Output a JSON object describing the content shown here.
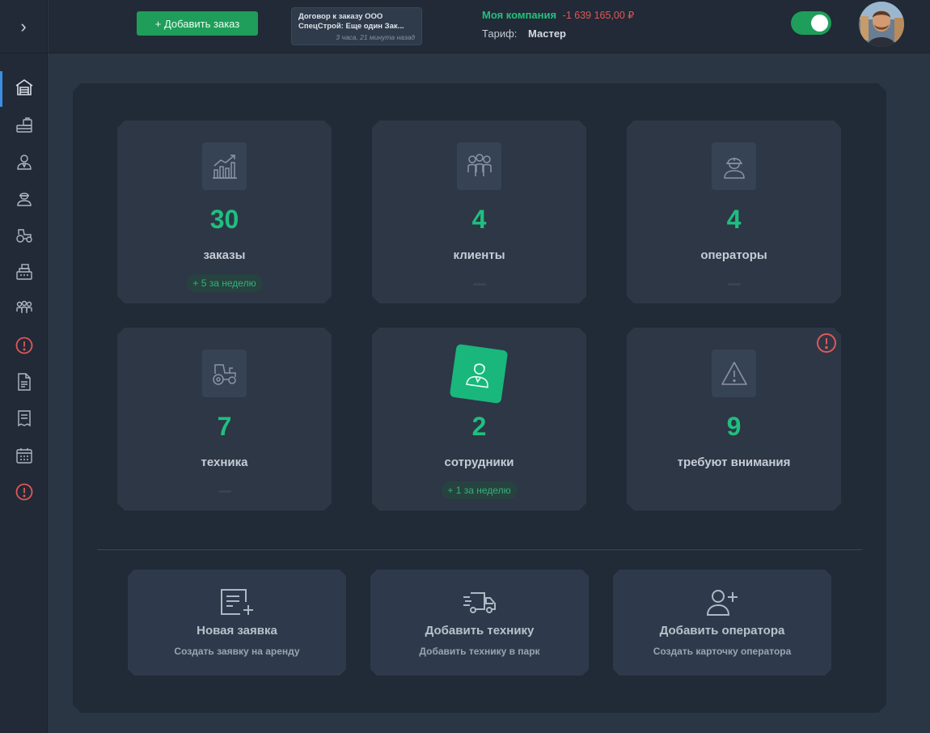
{
  "header": {
    "add_order_label": "+ Добавить заказ",
    "notification": {
      "title_line1": "Договор к заказу ООО",
      "title_line2": "СпецСтрой: Еще один Зак...",
      "time": "3 часа, 21 минута назад"
    },
    "company_name": "Моя компания",
    "company_balance": "-1 639 165,00 ₽",
    "tariff_label": "Тариф:",
    "tariff_value": "Мастер",
    "toggle_on": true
  },
  "sidebar": {
    "items": [
      {
        "icon": "warehouse-icon",
        "active": true
      },
      {
        "icon": "briefcase-stack-icon"
      },
      {
        "icon": "employee-icon"
      },
      {
        "icon": "operator-helmet-icon"
      },
      {
        "icon": "tractor-icon"
      },
      {
        "icon": "cash-register-icon"
      },
      {
        "icon": "clients-group-icon"
      },
      {
        "icon": "alert-icon"
      },
      {
        "icon": "document-icon"
      },
      {
        "icon": "receipt-icon"
      },
      {
        "icon": "calendar-icon"
      },
      {
        "icon": "alert-icon"
      }
    ]
  },
  "stats": [
    {
      "count": "30",
      "label": "заказы",
      "badge": "+ 5 за неделю",
      "icon": "chart-growth-icon"
    },
    {
      "count": "4",
      "label": "клиенты",
      "badge": "",
      "icon": "clients-group-icon"
    },
    {
      "count": "4",
      "label": "операторы",
      "badge": "",
      "icon": "operator-helmet-icon"
    },
    {
      "count": "7",
      "label": "техника",
      "badge": "",
      "icon": "tractor-icon"
    },
    {
      "count": "2",
      "label": "сотрудники",
      "badge": "+ 1 за неделю",
      "icon": "employee-icon"
    },
    {
      "count": "9",
      "label": "требуют внимания",
      "badge": "",
      "icon": "warning-triangle-icon"
    }
  ],
  "actions": [
    {
      "title": "Новая заявка",
      "subtitle": "Создать заявку на аренду",
      "icon": "new-request-icon"
    },
    {
      "title": "Добавить технику",
      "subtitle": "Добавить технику в парк",
      "icon": "truck-fast-icon"
    },
    {
      "title": "Добавить оператора",
      "subtitle": "Создать карточку оператора",
      "icon": "user-add-icon"
    }
  ],
  "colors": {
    "accent_green": "#1fbf7f",
    "alert_red": "#e0575a",
    "active_blue": "#3d8ee0"
  }
}
